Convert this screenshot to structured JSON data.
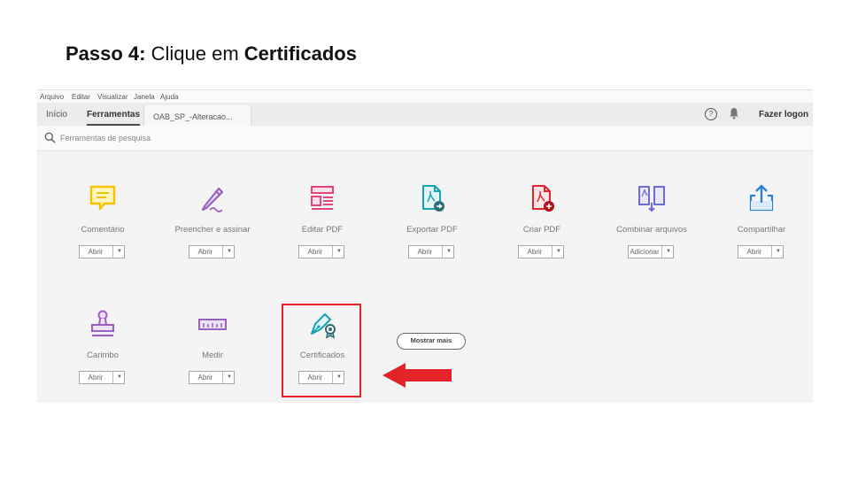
{
  "slide": {
    "step_label": "Passo 4:",
    "instruction_text": "Clique em",
    "target": "Certificados"
  },
  "menu": [
    "Arquivo",
    "Editar",
    "Visualizar",
    "Janela",
    "Ajuda"
  ],
  "tabs": {
    "home": "Início",
    "tools": "Ferramentas",
    "document": "OAB_SP_-Alteracao..."
  },
  "header": {
    "login": "Fazer logon",
    "help_glyph": "?"
  },
  "search": {
    "placeholder": "Ferramentas de pesquisa"
  },
  "tools": [
    {
      "label": "Comentário",
      "action": "Abrir",
      "icon": "comment-icon",
      "color": "#f5c400"
    },
    {
      "label": "Preencher e assinar",
      "action": "Abrir",
      "icon": "fill-sign-pen-icon",
      "color": "#9b5fc0"
    },
    {
      "label": "Editar PDF",
      "action": "Abrir",
      "icon": "edit-pdf-icon",
      "color": "#e0457b"
    },
    {
      "label": "Exportar PDF",
      "action": "Abrir",
      "icon": "export-pdf-icon",
      "color": "#12a3b4"
    },
    {
      "label": "Criar PDF",
      "action": "Abrir",
      "icon": "create-pdf-icon",
      "color": "#e3242b"
    },
    {
      "label": "Combinar arquivos",
      "action": "Adicionar",
      "icon": "combine-files-icon",
      "color": "#6d6bd6"
    },
    {
      "label": "Compartilhar",
      "action": "Abrir",
      "icon": "share-icon",
      "color": "#2d7fd3"
    },
    {
      "label": "Carimbo",
      "action": "Abrir",
      "icon": "stamp-icon",
      "color": "#9b5fc0"
    },
    {
      "label": "Medir",
      "action": "Abrir",
      "icon": "ruler-icon",
      "color": "#9b5fc0"
    },
    {
      "label": "Certificados",
      "action": "Abrir",
      "icon": "certificate-pen-icon",
      "color": "#12a3b4"
    }
  ],
  "more_button": "Mostrar mais",
  "colors": {
    "highlight": "#e3242b",
    "arrow": "#e3242b"
  }
}
